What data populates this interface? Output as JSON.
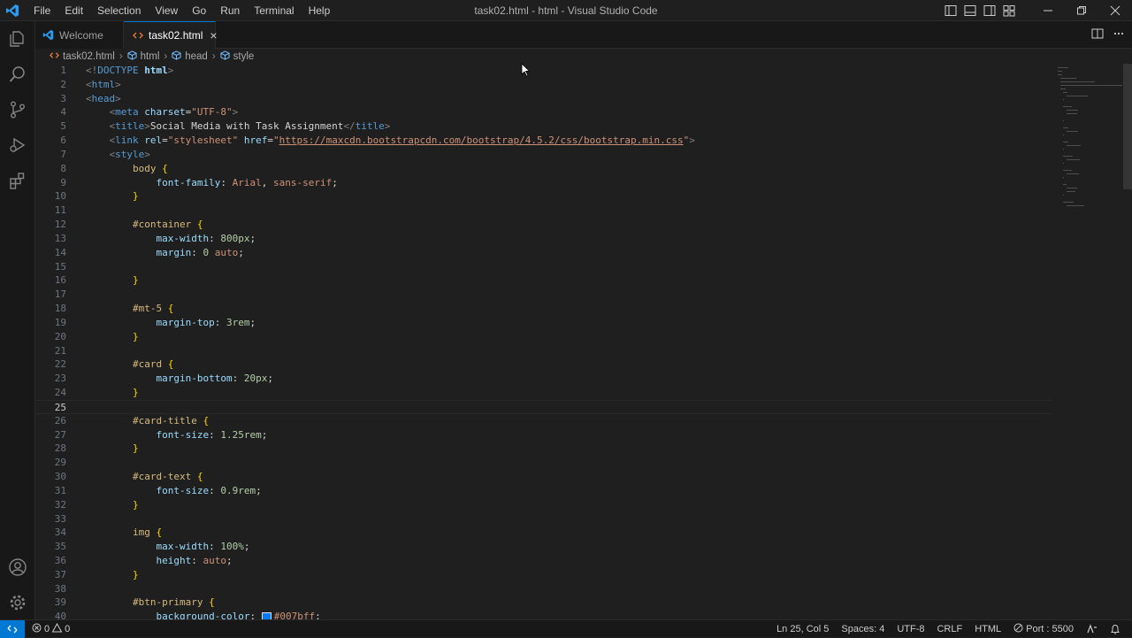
{
  "window": {
    "title": "task02.html - html - Visual Studio Code"
  },
  "menu": [
    "File",
    "Edit",
    "Selection",
    "View",
    "Go",
    "Run",
    "Terminal",
    "Help"
  ],
  "tabs": [
    {
      "label": "Welcome",
      "icon": "vscode-logo-icon",
      "active": false
    },
    {
      "label": "task02.html",
      "icon": "html-file-icon",
      "active": true,
      "close": "×"
    }
  ],
  "breadcrumb": [
    "task02.html",
    "html",
    "head",
    "style"
  ],
  "editor": {
    "current_line": 25,
    "lines": [
      {
        "n": "1",
        "t": [
          [
            "br",
            "<!"
          ],
          [
            "tag",
            "DOCTYPE"
          ],
          [
            "txt",
            " "
          ],
          [
            "bold",
            "html"
          ],
          [
            "br",
            ">"
          ]
        ]
      },
      {
        "n": "2",
        "t": [
          [
            "br",
            "<"
          ],
          [
            "tag",
            "html"
          ],
          [
            "br",
            ">"
          ]
        ]
      },
      {
        "n": "3",
        "t": [
          [
            "br",
            "<"
          ],
          [
            "tag",
            "head"
          ],
          [
            "br",
            ">"
          ]
        ]
      },
      {
        "n": "4",
        "t": [
          [
            "txt",
            "    "
          ],
          [
            "br",
            "<"
          ],
          [
            "tag",
            "meta"
          ],
          [
            "txt",
            " "
          ],
          [
            "attr",
            "charset"
          ],
          [
            "txt",
            "="
          ],
          [
            "str",
            "\"UTF-8\""
          ],
          [
            "br",
            ">"
          ]
        ]
      },
      {
        "n": "5",
        "t": [
          [
            "txt",
            "    "
          ],
          [
            "br",
            "<"
          ],
          [
            "tag",
            "title"
          ],
          [
            "br",
            ">"
          ],
          [
            "txt",
            "Social Media with Task Assignment"
          ],
          [
            "br",
            "</"
          ],
          [
            "tag",
            "title"
          ],
          [
            "br",
            ">"
          ]
        ]
      },
      {
        "n": "6",
        "t": [
          [
            "txt",
            "    "
          ],
          [
            "br",
            "<"
          ],
          [
            "tag",
            "link"
          ],
          [
            "txt",
            " "
          ],
          [
            "attr",
            "rel"
          ],
          [
            "txt",
            "="
          ],
          [
            "str",
            "\"stylesheet\""
          ],
          [
            "txt",
            " "
          ],
          [
            "attr",
            "href"
          ],
          [
            "txt",
            "="
          ],
          [
            "str",
            "\""
          ],
          [
            "url",
            "https://maxcdn.bootstrapcdn.com/bootstrap/4.5.2/css/bootstrap.min.css"
          ],
          [
            "str",
            "\""
          ],
          [
            "br",
            ">"
          ]
        ]
      },
      {
        "n": "7",
        "t": [
          [
            "txt",
            "    "
          ],
          [
            "br",
            "<"
          ],
          [
            "tag",
            "style"
          ],
          [
            "br",
            ">"
          ]
        ]
      },
      {
        "n": "8",
        "t": [
          [
            "txt",
            "        "
          ],
          [
            "sel",
            "body"
          ],
          [
            "txt",
            " "
          ],
          [
            "brace",
            "{"
          ]
        ]
      },
      {
        "n": "9",
        "t": [
          [
            "txt",
            "            "
          ],
          [
            "prop",
            "font-family"
          ],
          [
            "txt",
            ": "
          ],
          [
            "val",
            "Arial"
          ],
          [
            "txt",
            ", "
          ],
          [
            "val",
            "sans-serif"
          ],
          [
            "txt",
            ";"
          ]
        ]
      },
      {
        "n": "10",
        "t": [
          [
            "txt",
            "        "
          ],
          [
            "brace",
            "}"
          ]
        ]
      },
      {
        "n": "11",
        "t": []
      },
      {
        "n": "12",
        "t": [
          [
            "txt",
            "        "
          ],
          [
            "sel",
            "#container"
          ],
          [
            "txt",
            " "
          ],
          [
            "brace",
            "{"
          ]
        ]
      },
      {
        "n": "13",
        "t": [
          [
            "txt",
            "            "
          ],
          [
            "prop",
            "max-width"
          ],
          [
            "txt",
            ": "
          ],
          [
            "num",
            "800px"
          ],
          [
            "txt",
            ";"
          ]
        ]
      },
      {
        "n": "14",
        "t": [
          [
            "txt",
            "            "
          ],
          [
            "prop",
            "margin"
          ],
          [
            "txt",
            ": "
          ],
          [
            "num",
            "0"
          ],
          [
            "txt",
            " "
          ],
          [
            "val",
            "auto"
          ],
          [
            "txt",
            ";"
          ]
        ]
      },
      {
        "n": "15",
        "t": []
      },
      {
        "n": "16",
        "t": [
          [
            "txt",
            "        "
          ],
          [
            "brace",
            "}"
          ]
        ]
      },
      {
        "n": "17",
        "t": []
      },
      {
        "n": "18",
        "t": [
          [
            "txt",
            "        "
          ],
          [
            "sel",
            "#mt-5"
          ],
          [
            "txt",
            " "
          ],
          [
            "brace",
            "{"
          ]
        ]
      },
      {
        "n": "19",
        "t": [
          [
            "txt",
            "            "
          ],
          [
            "prop",
            "margin-top"
          ],
          [
            "txt",
            ": "
          ],
          [
            "num",
            "3rem"
          ],
          [
            "txt",
            ";"
          ]
        ]
      },
      {
        "n": "20",
        "t": [
          [
            "txt",
            "        "
          ],
          [
            "brace",
            "}"
          ]
        ]
      },
      {
        "n": "21",
        "t": []
      },
      {
        "n": "22",
        "t": [
          [
            "txt",
            "        "
          ],
          [
            "sel",
            "#card"
          ],
          [
            "txt",
            " "
          ],
          [
            "brace",
            "{"
          ]
        ]
      },
      {
        "n": "23",
        "t": [
          [
            "txt",
            "            "
          ],
          [
            "prop",
            "margin-bottom"
          ],
          [
            "txt",
            ": "
          ],
          [
            "num",
            "20px"
          ],
          [
            "txt",
            ";"
          ]
        ]
      },
      {
        "n": "24",
        "t": [
          [
            "txt",
            "        "
          ],
          [
            "brace",
            "}"
          ]
        ]
      },
      {
        "n": "25",
        "t": []
      },
      {
        "n": "26",
        "t": [
          [
            "txt",
            "        "
          ],
          [
            "sel",
            "#card-title"
          ],
          [
            "txt",
            " "
          ],
          [
            "brace",
            "{"
          ]
        ]
      },
      {
        "n": "27",
        "t": [
          [
            "txt",
            "            "
          ],
          [
            "prop",
            "font-size"
          ],
          [
            "txt",
            ": "
          ],
          [
            "num",
            "1.25rem"
          ],
          [
            "txt",
            ";"
          ]
        ]
      },
      {
        "n": "28",
        "t": [
          [
            "txt",
            "        "
          ],
          [
            "brace",
            "}"
          ]
        ]
      },
      {
        "n": "29",
        "t": []
      },
      {
        "n": "30",
        "t": [
          [
            "txt",
            "        "
          ],
          [
            "sel",
            "#card-text"
          ],
          [
            "txt",
            " "
          ],
          [
            "brace",
            "{"
          ]
        ]
      },
      {
        "n": "31",
        "t": [
          [
            "txt",
            "            "
          ],
          [
            "prop",
            "font-size"
          ],
          [
            "txt",
            ": "
          ],
          [
            "num",
            "0.9rem"
          ],
          [
            "txt",
            ";"
          ]
        ]
      },
      {
        "n": "32",
        "t": [
          [
            "txt",
            "        "
          ],
          [
            "brace",
            "}"
          ]
        ]
      },
      {
        "n": "33",
        "t": []
      },
      {
        "n": "34",
        "t": [
          [
            "txt",
            "        "
          ],
          [
            "sel",
            "img"
          ],
          [
            "txt",
            " "
          ],
          [
            "brace",
            "{"
          ]
        ]
      },
      {
        "n": "35",
        "t": [
          [
            "txt",
            "            "
          ],
          [
            "prop",
            "max-width"
          ],
          [
            "txt",
            ": "
          ],
          [
            "num",
            "100%"
          ],
          [
            "txt",
            ";"
          ]
        ]
      },
      {
        "n": "36",
        "t": [
          [
            "txt",
            "            "
          ],
          [
            "prop",
            "height"
          ],
          [
            "txt",
            ": "
          ],
          [
            "val",
            "auto"
          ],
          [
            "txt",
            ";"
          ]
        ]
      },
      {
        "n": "37",
        "t": [
          [
            "txt",
            "        "
          ],
          [
            "brace",
            "}"
          ]
        ]
      },
      {
        "n": "38",
        "t": []
      },
      {
        "n": "39",
        "t": [
          [
            "txt",
            "        "
          ],
          [
            "sel",
            "#btn-primary"
          ],
          [
            "txt",
            " "
          ],
          [
            "brace",
            "{"
          ]
        ]
      },
      {
        "n": "40",
        "t": [
          [
            "txt",
            "            "
          ],
          [
            "prop",
            "background-color"
          ],
          [
            "txt",
            ": "
          ],
          [
            "swatch",
            "#007bff"
          ],
          [
            "val",
            "#007bff"
          ],
          [
            "txt",
            ";"
          ]
        ]
      }
    ]
  },
  "status": {
    "problems": {
      "errors": "0",
      "warnings": "0"
    },
    "position": "Ln 25, Col 5",
    "spaces": "Spaces: 4",
    "encoding": "UTF-8",
    "eol": "CRLF",
    "language": "HTML",
    "port": "Port : 5500"
  },
  "colors": {
    "accent": "#0078d4",
    "swatch": "#007bff"
  }
}
